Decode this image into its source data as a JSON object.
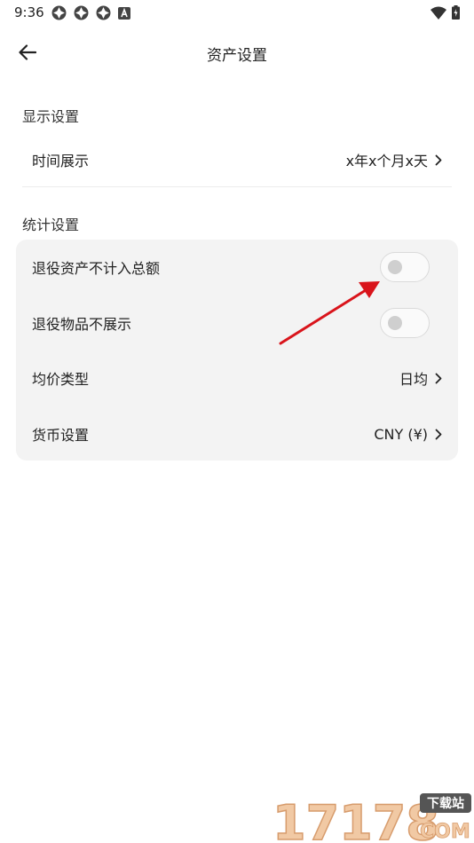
{
  "status_bar": {
    "time": "9:36",
    "left_icons": [
      "app-notification-icon",
      "app-notification-icon",
      "app-notification-icon",
      "a-badge-icon"
    ],
    "right_icons": [
      "wifi-icon",
      "battery-charging-icon"
    ]
  },
  "header": {
    "title": "资产设置",
    "back_icon": "arrow-left-icon"
  },
  "display_section": {
    "title": "显示设置",
    "items": [
      {
        "label": "时间展示",
        "value": "x年x个月x天",
        "icon": "chevron-right-icon"
      }
    ]
  },
  "stats_section": {
    "title": "统计设置",
    "items": [
      {
        "label": "退役资产不计入总额",
        "type": "toggle",
        "on": false
      },
      {
        "label": "退役物品不展示",
        "type": "toggle",
        "on": false
      },
      {
        "label": "均价类型",
        "value": "日均",
        "icon": "chevron-right-icon"
      },
      {
        "label": "货币设置",
        "value": "CNY (¥)",
        "icon": "chevron-right-icon"
      }
    ]
  },
  "annotation": {
    "type": "red-arrow",
    "color": "#d9141b"
  },
  "watermark": {
    "number": "17178",
    "badge": "下载站",
    "domain": "COM"
  }
}
